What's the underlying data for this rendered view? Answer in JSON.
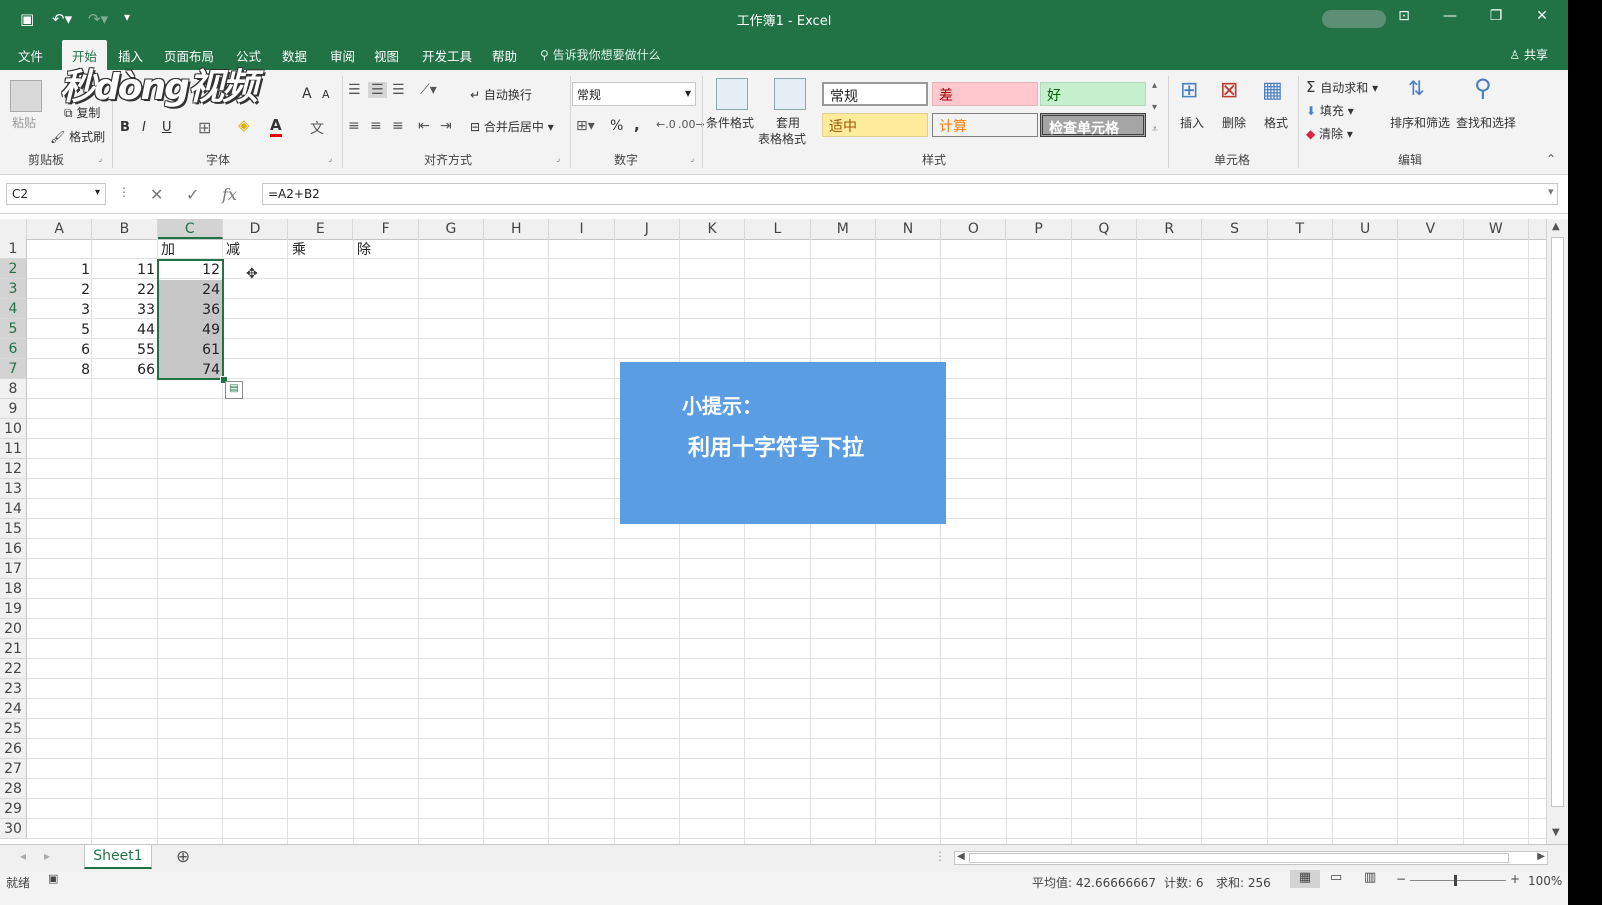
{
  "window": {
    "title": "工作簿1 - Excel"
  },
  "tabs": [
    "文件",
    "开始",
    "插入",
    "页面布局",
    "公式",
    "数据",
    "审阅",
    "视图",
    "开发工具",
    "帮助"
  ],
  "tell_me": "告诉我你想要做什么",
  "share_label": "共享",
  "watermark_logo": "秒懂视频",
  "ribbon": {
    "clipboard": {
      "paste": "粘贴",
      "copy": "复制",
      "format_painter": "格式刷",
      "label": "剪贴板"
    },
    "font": {
      "bold": "B",
      "italic": "I",
      "underline": "U",
      "font_color_glyph": "A",
      "grow": "A",
      "shrink": "A",
      "label": "字体"
    },
    "alignment": {
      "wrap": "自动换行",
      "merge": "合并后居中",
      "label": "对齐方式"
    },
    "number": {
      "format": "常规",
      "percent": "%",
      "comma": ",",
      "label": "数字"
    },
    "styles": {
      "cond_format": "条件格式",
      "table_format_1": "套用",
      "table_format_2": "表格格式",
      "normal": "常规",
      "bad": "差",
      "good": "好",
      "neutral": "适中",
      "calc": "计算",
      "check": "检查单元格",
      "label": "样式"
    },
    "cells": {
      "insert": "插入",
      "delete": "删除",
      "format": "格式",
      "label": "单元格"
    },
    "editing": {
      "autosum": "自动求和",
      "fill": "填充",
      "clear": "清除",
      "sort": "排序和筛选",
      "find": "查找和选择",
      "label": "编辑"
    }
  },
  "formula_bar": {
    "name_box": "C2",
    "fx": "fx",
    "formula": "=A2+B2"
  },
  "columns": [
    "A",
    "B",
    "C",
    "D",
    "E",
    "F",
    "G",
    "H",
    "I",
    "J",
    "K",
    "L",
    "M",
    "N",
    "O",
    "P",
    "Q",
    "R",
    "S",
    "T",
    "U",
    "V",
    "W"
  ],
  "rows": [
    "1",
    "2",
    "3",
    "4",
    "5",
    "6",
    "7",
    "8",
    "9",
    "10",
    "11",
    "12",
    "13",
    "14",
    "15",
    "16",
    "17",
    "18",
    "19",
    "20",
    "21",
    "22",
    "23",
    "24",
    "25",
    "26",
    "27",
    "28",
    "29",
    "30"
  ],
  "headers_row1": {
    "C": "加",
    "D": "减",
    "E": "乘",
    "F": "除"
  },
  "data": {
    "A": [
      "1",
      "2",
      "3",
      "5",
      "6",
      "8"
    ],
    "B": [
      "11",
      "22",
      "33",
      "44",
      "55",
      "66"
    ],
    "C": [
      "12",
      "24",
      "36",
      "49",
      "61",
      "74"
    ]
  },
  "tip": {
    "line1": "小提示：",
    "line2": "利用十字符号下拉"
  },
  "sheet_tab": "Sheet1",
  "status": {
    "ready": "就绪",
    "average": "平均值: 42.66666667",
    "count": "计数: 6",
    "sum": "求和: 256",
    "zoom": "100%"
  },
  "colors": {
    "excel_green": "#217346",
    "tip_blue": "#5b9de3",
    "style_bad_bg": "#ffc7ce",
    "style_good_bg": "#c6efce",
    "style_neutral_bg": "#ffeb9c",
    "style_check_bg": "#a5a5a5"
  }
}
